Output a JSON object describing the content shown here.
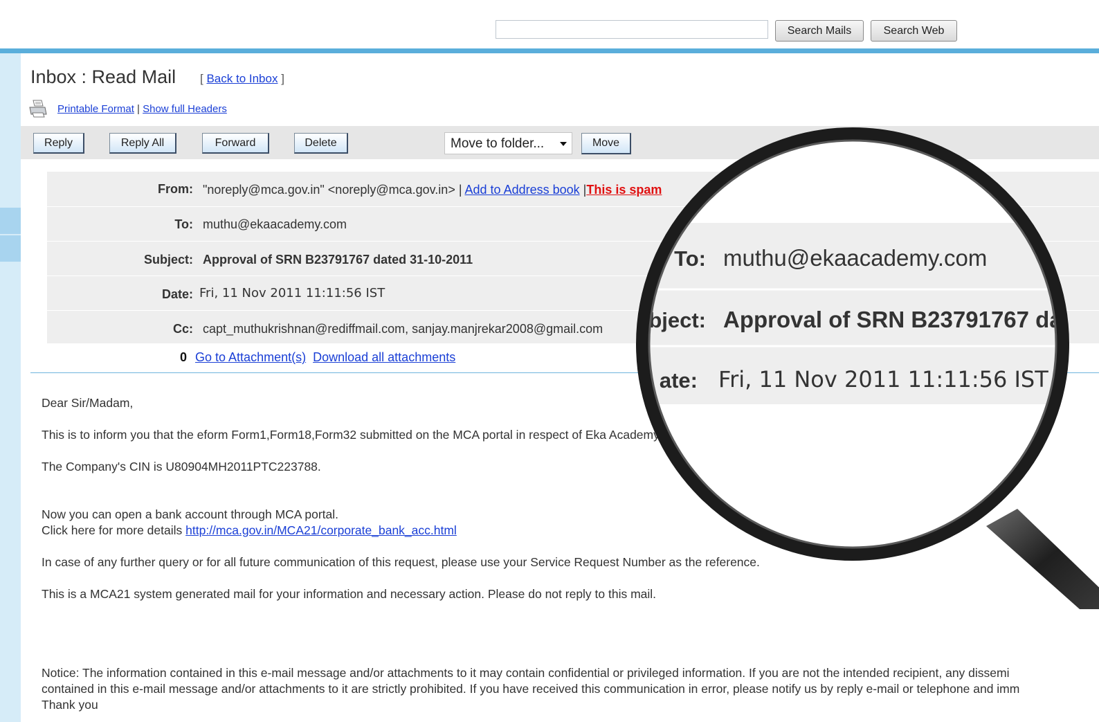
{
  "search": {
    "placeholder": "",
    "mails_label": "Search Mails",
    "web_label": "Search Web"
  },
  "heading": {
    "title": "Inbox : Read Mail",
    "back_open": "[ ",
    "back_label": "Back to Inbox",
    "back_close": " ]",
    "printable_label": "Printable Format",
    "separator": " | ",
    "headers_label": "Show  full Headers"
  },
  "toolbar": {
    "reply": "Reply",
    "reply_all": "Reply All",
    "forward": "Forward",
    "delete": "Delete",
    "folder_select": "Move to folder...",
    "move": "Move"
  },
  "headers": {
    "from_label": "From:",
    "from_value": "\"noreply@mca.gov.in\" <noreply@mca.gov.in> | ",
    "add_address": "Add to Address book",
    "spam_sep": " |",
    "spam": "This is spam",
    "to_label": "To:",
    "to_value": "muthu@ekaacademy.com",
    "subject_label": "Subject:",
    "subject_value": "Approval of SRN B23791767 dated 31-10-2011",
    "date_label": "Date:",
    "date_value": "Fri, 11 Nov 2011 11:11:56 IST",
    "cc_label": "Cc:",
    "cc_value": "capt_muthukrishnan@rediffmail.com, sanjay.manjrekar2008@gmail.com",
    "attach_link": "Go to Attachment(s)",
    "download_link": "Download all attachments"
  },
  "body": {
    "greeting": "Dear Sir/Madam,",
    "line1": "This is to inform you that the eform Form1,Form18,Form32 submitted on the MCA portal in respect of Eka Academy Private Limited vide SRN B23791767 dated 31-10-2011 has been",
    "line2": "The Company's CIN is U80904MH2011PTC223788.",
    "line3": "Now you can open a bank account through MCA portal.",
    "line4": "Click here for more details ",
    "link": "http://mca.gov.in/MCA21/corporate_bank_acc.html",
    "line5": "In case of any further query or for all future communication of this request, please use your Service Request Number as the reference.",
    "line6": "This is a MCA21 system generated mail for your information and necessary action. Please do not reply to this mail.",
    "notice1": "Notice: The information contained in this e-mail message and/or attachments to it may contain confidential or privileged information. If you are not the intended recipient, any dissemi",
    "notice2": "contained in this e-mail message and/or attachments to it are strictly prohibited. If you have received this communication in error, please notify us by reply e-mail or telephone and imm",
    "notice3": "Thank you"
  },
  "magnified": {
    "to_label": "To:",
    "to_value": "muthu@ekaacademy.com",
    "subject_label": "bject:",
    "subject_value": "Approval of SRN B23791767 dat",
    "date_label": "ate:",
    "date_value": "Fri, 11 Nov 2011 11:11:56 IST"
  }
}
